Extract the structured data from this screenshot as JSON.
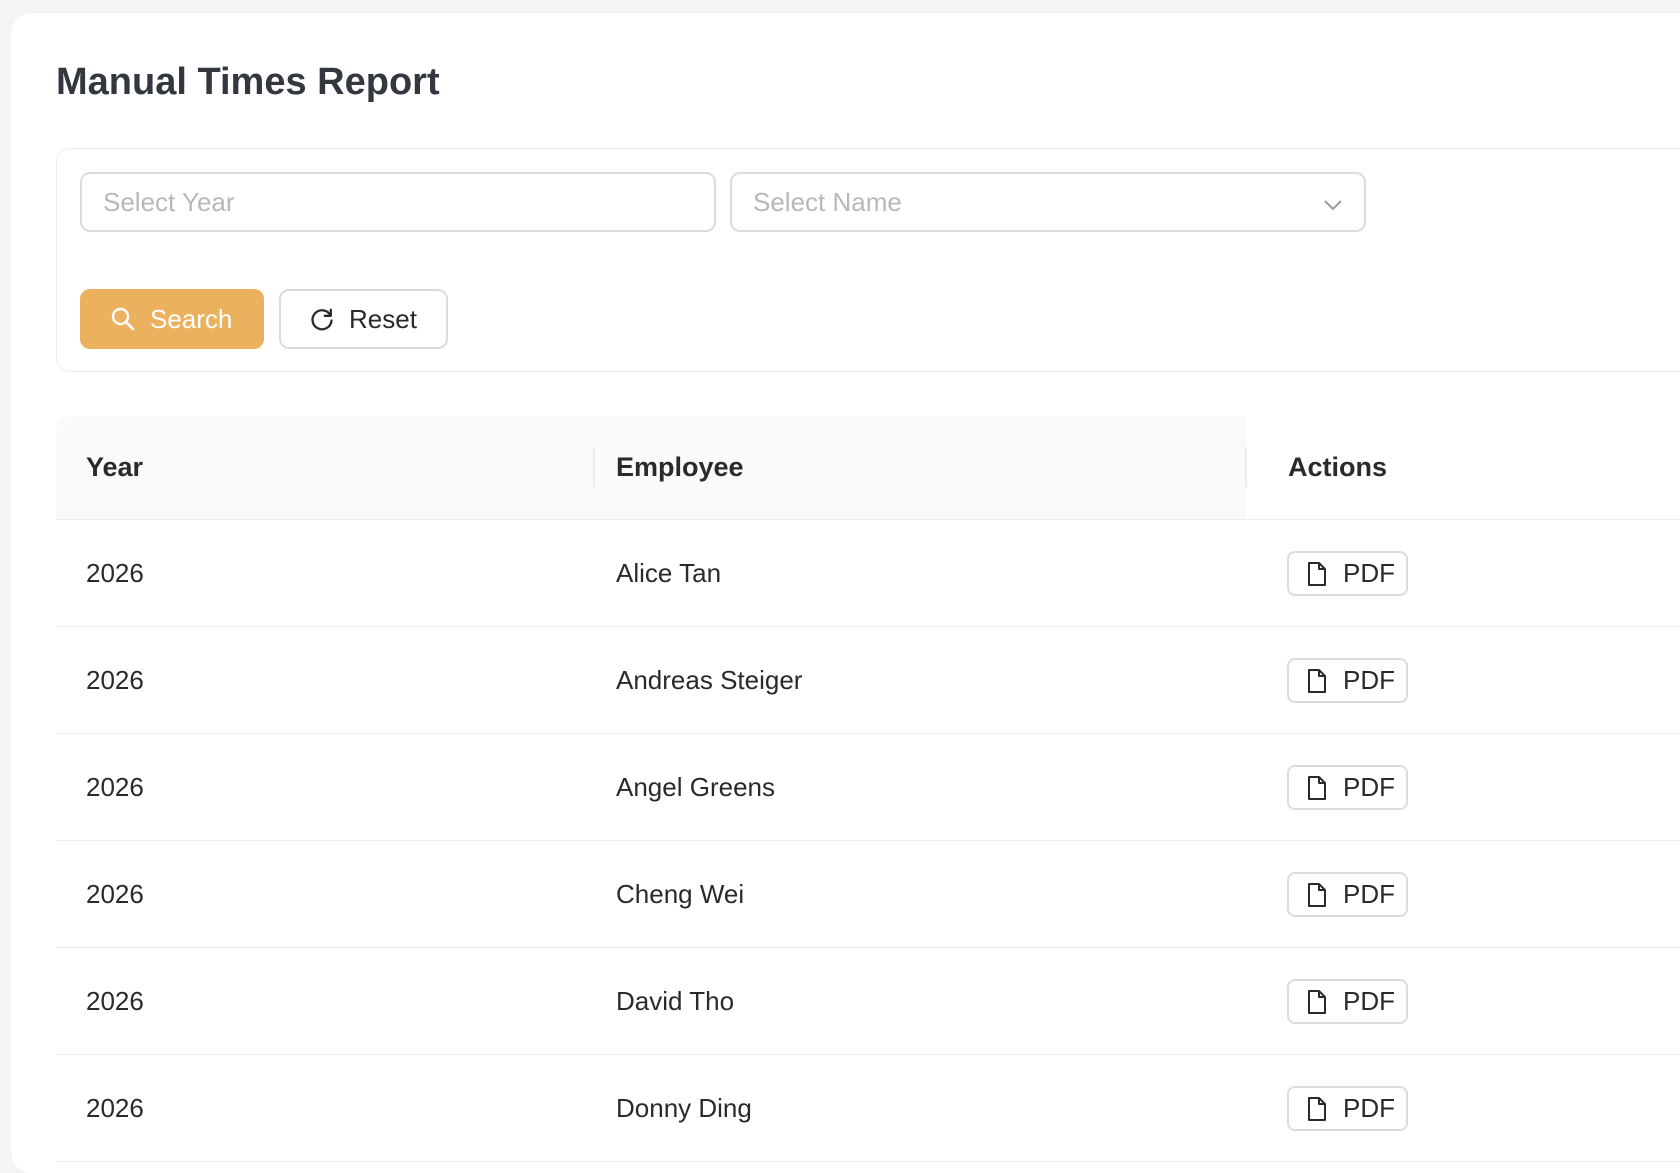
{
  "page": {
    "title": "Manual Times Report"
  },
  "filters": {
    "year_placeholder": "Select Year",
    "name_placeholder": "Select Name",
    "search_label": "Search",
    "reset_label": "Reset",
    "accent_color": "#ecb15f"
  },
  "icons": {
    "search": "search-icon",
    "reset": "reload-icon",
    "dropdown": "chevron-down-icon",
    "pdf": "file-icon"
  },
  "table": {
    "columns": [
      "Year",
      "Employee",
      "Actions"
    ],
    "rows": [
      {
        "year": "2026",
        "employee": "Alice Tan",
        "action": "PDF"
      },
      {
        "year": "2026",
        "employee": "Andreas Steiger",
        "action": "PDF"
      },
      {
        "year": "2026",
        "employee": "Angel Greens",
        "action": "PDF"
      },
      {
        "year": "2026",
        "employee": "Cheng Wei",
        "action": "PDF"
      },
      {
        "year": "2026",
        "employee": "David Tho",
        "action": "PDF"
      },
      {
        "year": "2026",
        "employee": "Donny Ding",
        "action": "PDF"
      }
    ]
  }
}
